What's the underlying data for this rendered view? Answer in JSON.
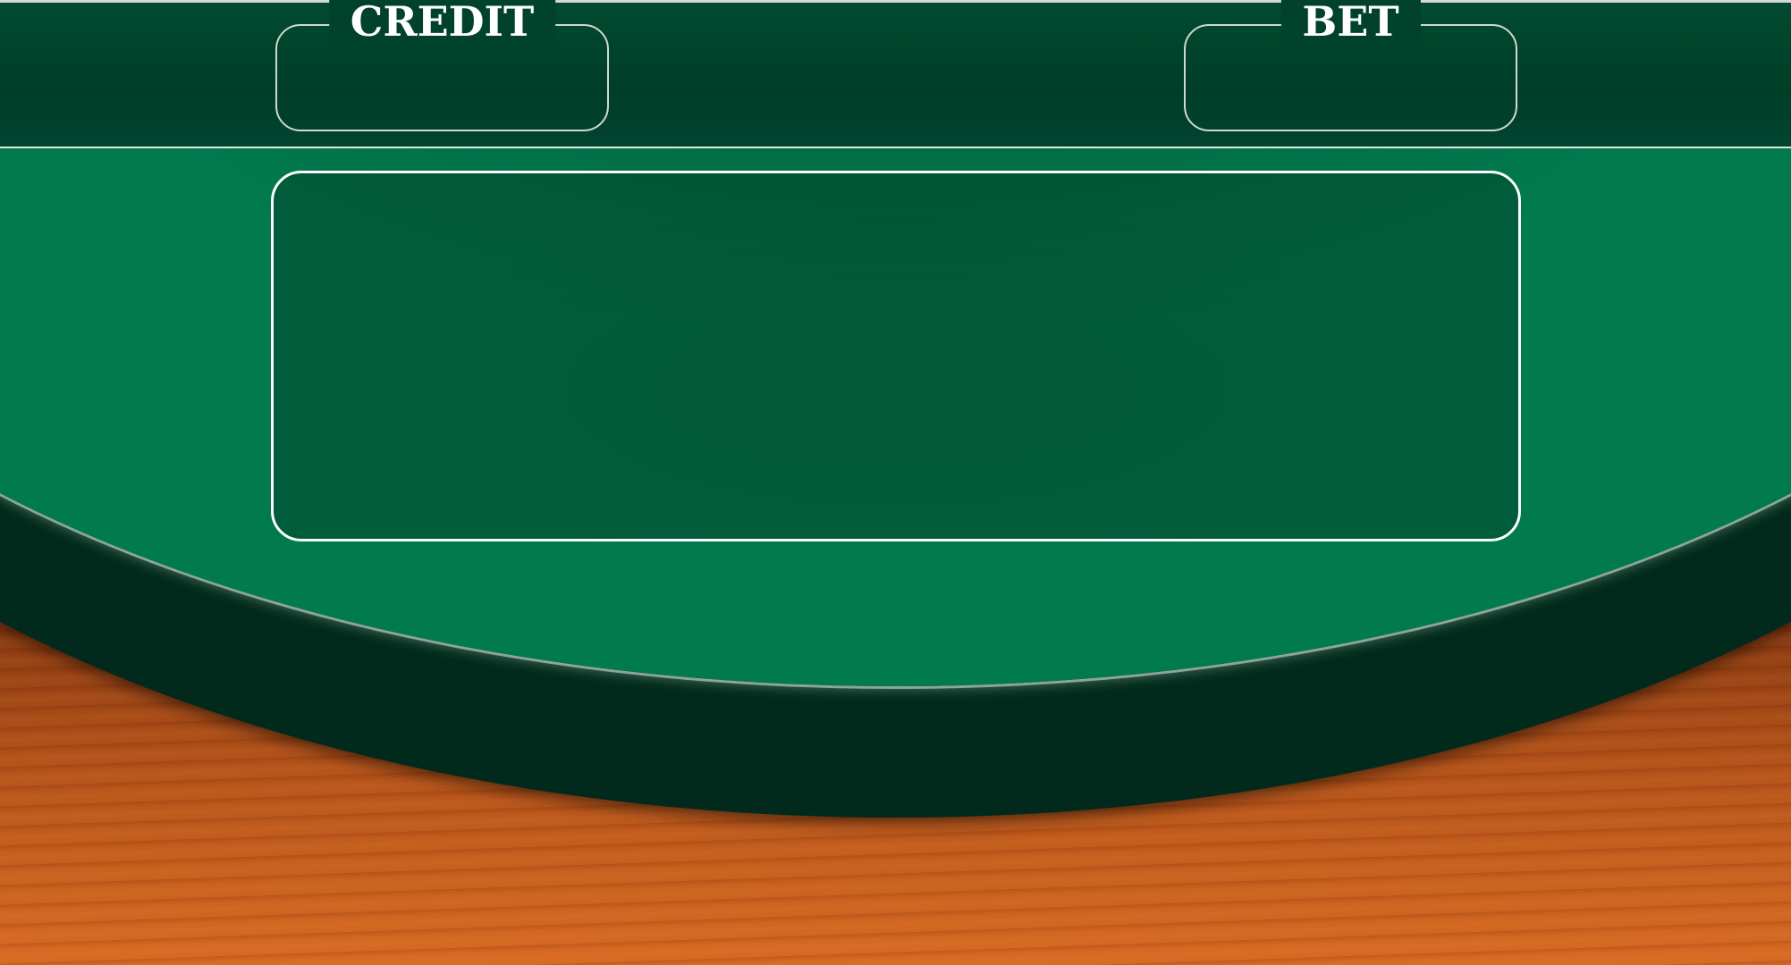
{
  "hud": {
    "credit": {
      "label": "CREDIT",
      "value": ""
    },
    "bet": {
      "label": "BET",
      "value": ""
    }
  },
  "table": {
    "play_area_content": ""
  },
  "colors": {
    "felt": "#017a4e",
    "header": "#003e28",
    "rail": "#012a1c",
    "wood": "#b5531a",
    "frame_line": "#ffffff"
  }
}
